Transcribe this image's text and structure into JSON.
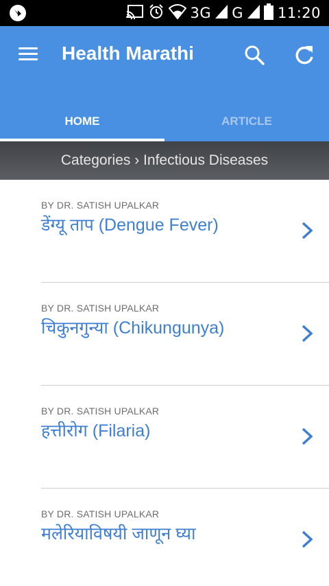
{
  "status_bar": {
    "network_3g": "3G",
    "network_g": "G",
    "time": "11:20",
    "icons": [
      "app-notification-icon",
      "cast-icon",
      "alarm-icon",
      "wifi-icon",
      "signal-icon",
      "signal-icon",
      "battery-icon"
    ]
  },
  "app_bar": {
    "title": "Health Marathi",
    "color": "#4a90e2",
    "icons": [
      "menu-icon",
      "search-icon",
      "refresh-icon"
    ]
  },
  "tabs": [
    {
      "label": "HOME",
      "active": true
    },
    {
      "label": "ARTICLE",
      "active": false
    }
  ],
  "breadcrumb": "Categories › Infectious Diseases",
  "articles": [
    {
      "author": "BY DR. SATISH UPALKAR",
      "title": "डेंग्यू ताप (Dengue Fever)"
    },
    {
      "author": "BY DR. SATISH UPALKAR",
      "title": "चिकुनगुन्या (Chikungunya)"
    },
    {
      "author": "BY DR. SATISH UPALKAR",
      "title": "हत्तीरोग (Filaria)"
    },
    {
      "author": "BY DR. SATISH UPALKAR",
      "title": "मलेरियाविषयी जाणून घ्या"
    }
  ]
}
